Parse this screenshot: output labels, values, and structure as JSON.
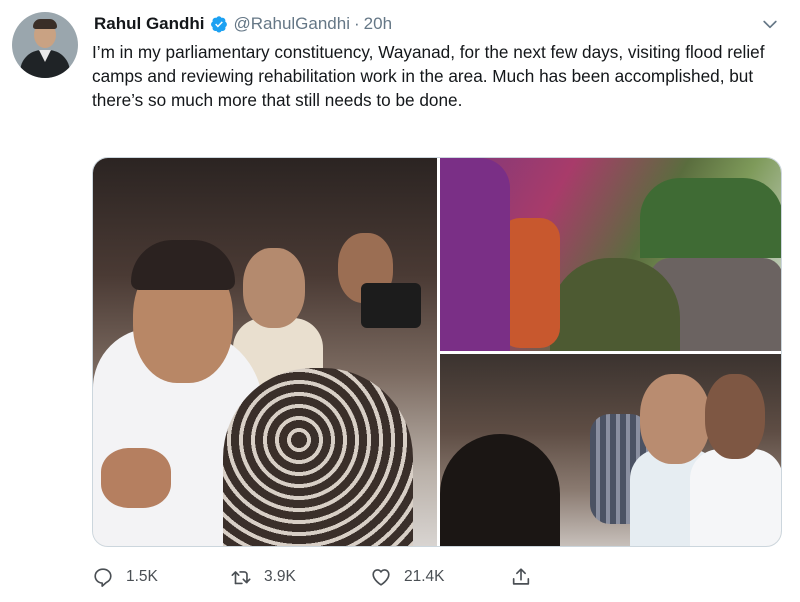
{
  "tweet": {
    "author_name": "Rahul Gandhi",
    "handle": "@RahulGandhi",
    "separator": "·",
    "time": "20h",
    "text": "I’m in my parliamentary constituency, Wayanad, for the next few days, visiting flood relief camps and reviewing rehabilitation work in the area. Much has been accomplished, but there’s so much more that still needs to be done."
  },
  "actions": {
    "replies": "1.5K",
    "retweets": "3.9K",
    "likes": "21.4K"
  },
  "icons": {
    "verified": "verified-badge-icon",
    "caret": "chevron-down-icon",
    "reply": "reply-icon",
    "retweet": "retweet-icon",
    "like": "heart-icon",
    "share": "share-icon"
  },
  "colors": {
    "verified": "#1da1f2",
    "secondary_text": "#657786"
  }
}
